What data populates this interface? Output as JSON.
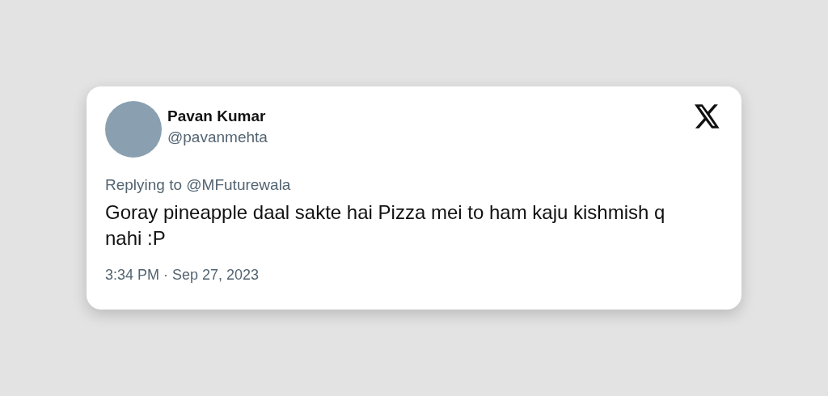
{
  "tweet": {
    "name": "Pavan Kumar",
    "handle": "@pavanmehta",
    "replying_to": "Replying to @MFuturewala",
    "text": "Goray pineapple daal sakte hai Pizza mei to ham kaju kishmish q nahi :P",
    "timestamp": "3:34 PM · Sep 27, 2023"
  }
}
